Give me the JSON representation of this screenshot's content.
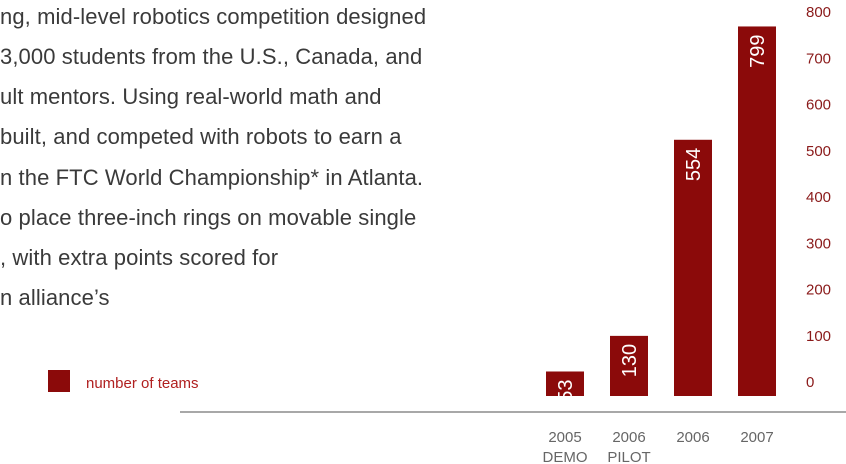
{
  "body_text": [
    "ng, mid-level robotics competition designed",
    "3,000 students from the U.S., Canada, and",
    "ult mentors. Using real-world math and",
    " built, and competed with robots to earn a",
    "n the FTC World Championship* in Atlanta.",
    "o place three-inch rings on movable single",
    ", with extra points scored for",
    "n alliance’s"
  ],
  "legend": {
    "label": "number of teams",
    "color": "#8b0a0a"
  },
  "chart_data": {
    "type": "bar",
    "categories": [
      [
        "2005",
        "DEMO"
      ],
      [
        "2006",
        "PILOT"
      ],
      [
        "2006"
      ],
      [
        "2007"
      ]
    ],
    "values": [
      53,
      130,
      554,
      799
    ],
    "ylim": [
      0,
      800
    ],
    "yticks": [
      0,
      100,
      200,
      300,
      400,
      500,
      600,
      700,
      800
    ],
    "axis_position": "right",
    "grid": false,
    "bar_color": "#8b0a0a",
    "value_labels_rotated": true
  }
}
